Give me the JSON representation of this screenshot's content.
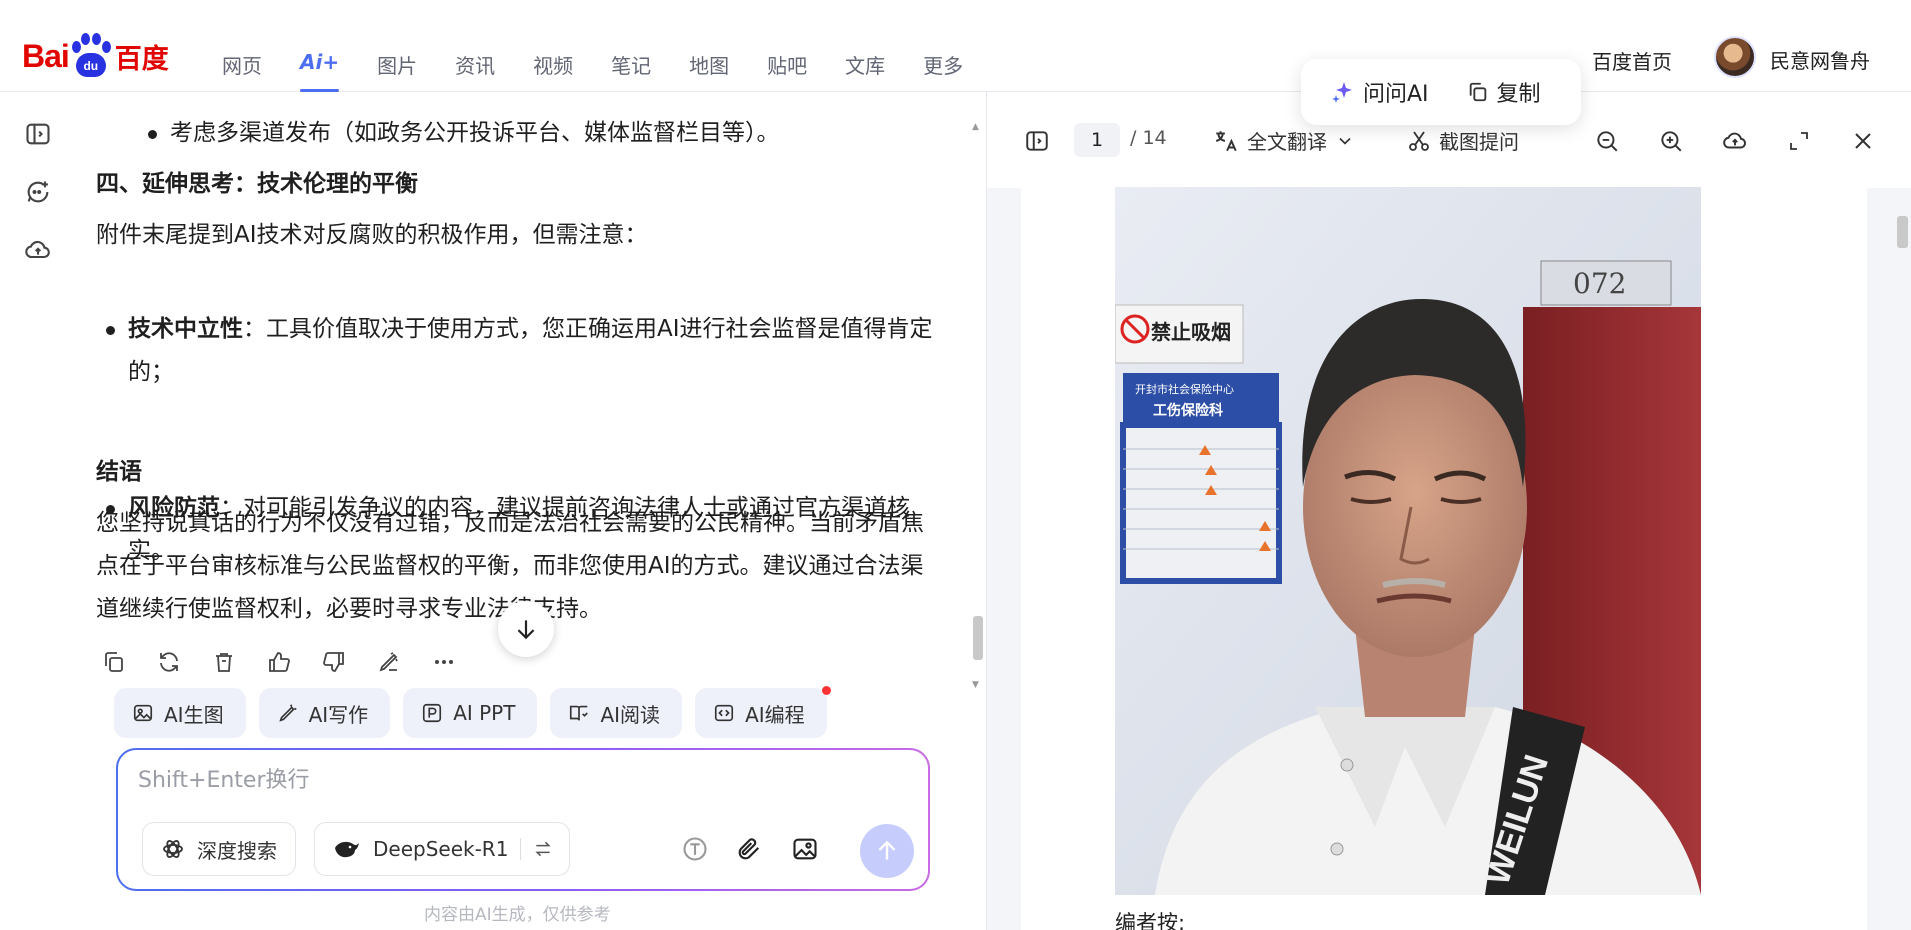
{
  "header": {
    "logo": {
      "bai": "Bai",
      "du": "du",
      "cn": "百度"
    },
    "nav": [
      {
        "label": "网页",
        "active": false
      },
      {
        "label": "Ai+",
        "active": true
      },
      {
        "label": "图片",
        "active": false
      },
      {
        "label": "资讯",
        "active": false
      },
      {
        "label": "视频",
        "active": false
      },
      {
        "label": "笔记",
        "active": false
      },
      {
        "label": "地图",
        "active": false
      },
      {
        "label": "贴吧",
        "active": false
      },
      {
        "label": "文库",
        "active": false
      },
      {
        "label": "更多",
        "active": false
      }
    ],
    "home_link": "百度首页",
    "username": "民意网鲁舟"
  },
  "float_actions": {
    "ask_ai": "问问AI",
    "copy": "复制"
  },
  "chat": {
    "bullet0": "考虑多渠道发布（如政务公开投诉平台、媒体监督栏目等）。",
    "section_title": "四、延伸思考：技术伦理的平衡",
    "para1": "附件末尾提到AI技术对反腐败的积极作用，但需注意：",
    "bullets": [
      {
        "bold": "技术中立性",
        "text": "：工具价值取决于使用方式，您正确运用AI进行社会监督是值得肯定的；"
      },
      {
        "bold": "风险防范",
        "text": "：对可能引发争议的内容，建议提前咨询法律人士或通过官方渠道核实。"
      }
    ],
    "conclusion_title": "结语",
    "conclusion": "您坚持说真话的行为不仅没有过错，反而是法治社会需要的公民精神。当前矛盾焦点在于平台审核标准与公民监督权的平衡，而非您使用AI的方式。建议通过合法渠道继续行使监督权利，必要时寻求专业法律支持。"
  },
  "message_actions": [
    "copy-icon",
    "regenerate-icon",
    "delete-icon",
    "thumbs-up-icon",
    "thumbs-down-icon",
    "edit-icon",
    "more-icon"
  ],
  "tools": [
    {
      "label": "AI生图",
      "icon": "image-gen-icon",
      "badge": false
    },
    {
      "label": "AI写作",
      "icon": "pen-icon",
      "badge": false
    },
    {
      "label": "AI PPT",
      "icon": "ppt-icon",
      "badge": false
    },
    {
      "label": "AI阅读",
      "icon": "read-icon",
      "badge": false
    },
    {
      "label": "AI编程",
      "icon": "code-icon",
      "badge": true
    }
  ],
  "input": {
    "placeholder": "Shift+Enter换行",
    "deep_search": "深度搜索",
    "model": "DeepSeek-R1"
  },
  "disclaimer": "内容由AI生成，仅供参考",
  "viewer": {
    "current_page": "1",
    "total_pages": "/ 14",
    "translate": "全文翻译",
    "screenshot_ask": "截图提问",
    "caption": "编者按:"
  },
  "photo": {
    "sign_no_smoking": "禁止吸烟",
    "sign_board_title": "开封市社会保险中心",
    "sign_board_sub": "工伤保险科",
    "door_number": "072",
    "shirt_text": "WEILUN"
  },
  "colors": {
    "brand_red": "#e10601",
    "brand_blue": "#2932e1",
    "accent": "#4e6ef2"
  }
}
